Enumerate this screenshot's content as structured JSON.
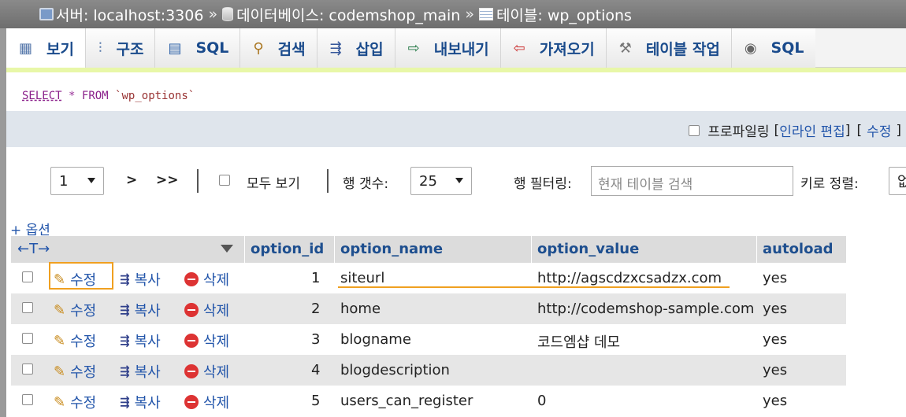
{
  "breadcrumb": {
    "server": "서버: localhost:3306",
    "database": "데이터베이스: codemshop_main",
    "table": "테이블: wp_options",
    "separator": "»"
  },
  "tabs": [
    {
      "label": "보기",
      "icon": "browse-icon"
    },
    {
      "label": "구조",
      "icon": "structure-icon"
    },
    {
      "label": "SQL",
      "icon": "sql-icon"
    },
    {
      "label": "검색",
      "icon": "search-icon"
    },
    {
      "label": "삽입",
      "icon": "insert-icon"
    },
    {
      "label": "내보내기",
      "icon": "export-icon"
    },
    {
      "label": "가져오기",
      "icon": "import-icon"
    },
    {
      "label": "테이블 작업",
      "icon": "wrench-icon"
    },
    {
      "label": "SQL",
      "icon": "eye-icon"
    }
  ],
  "query": {
    "select": "SELECT",
    "star": "*",
    "from": "FROM",
    "table": "`wp_options`"
  },
  "profiling": {
    "label": "프로파일링",
    "bracket_open": "[",
    "inline_edit": "인라인 편집",
    "bracket_close": "]",
    "bracket_open2": "[",
    "edit": "수정",
    "bracket_close2": "]"
  },
  "navigation": {
    "page_value": "1",
    "next": ">",
    "last": ">>",
    "show_all": "모두 보기",
    "rows_label": "행 갯수:",
    "rows_value": "25",
    "filter_label": "행 필터링:",
    "filter_placeholder": "현재 테이블 검색",
    "sort_label": "키로 정렬:",
    "sort_value": "없"
  },
  "options_link": "+ 옵션",
  "table": {
    "columns": [
      "option_id",
      "option_name",
      "option_value",
      "autoload"
    ],
    "actions": {
      "edit": "수정",
      "copy": "복사",
      "delete": "삭제"
    },
    "rows": [
      {
        "option_id": "1",
        "option_name": "siteurl",
        "option_value": "http://agscdzxcsadzx.com",
        "autoload": "yes"
      },
      {
        "option_id": "2",
        "option_name": "home",
        "option_value": "http://codemshop-sample.com",
        "autoload": "yes"
      },
      {
        "option_id": "3",
        "option_name": "blogname",
        "option_value": "코드엠샵 데모",
        "autoload": "yes"
      },
      {
        "option_id": "4",
        "option_name": "blogdescription",
        "option_value": "",
        "autoload": "yes"
      },
      {
        "option_id": "5",
        "option_name": "users_can_register",
        "option_value": "0",
        "autoload": "yes"
      }
    ]
  },
  "colors": {
    "link": "#2255aa",
    "highlight": "#f0a020",
    "header_bg": "#dcdcdc"
  }
}
